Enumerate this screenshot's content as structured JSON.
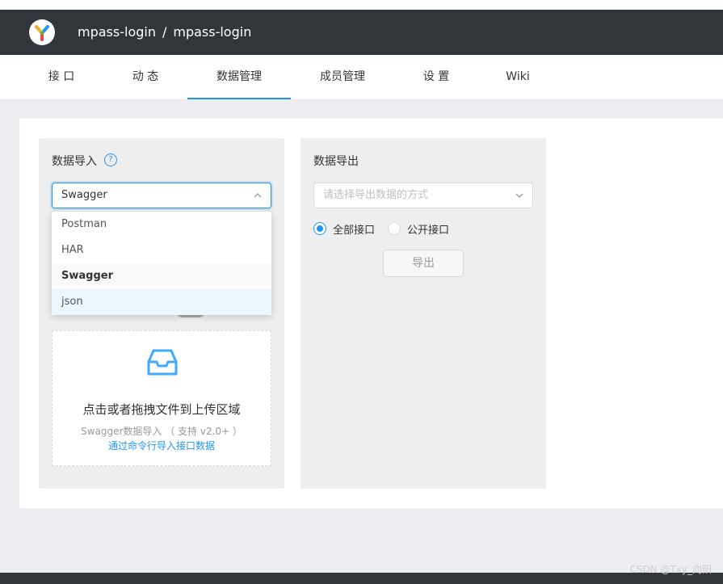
{
  "header": {
    "logo_icon": "yapi-logo",
    "group": "mpass-login",
    "separator": "/",
    "project": "mpass-login"
  },
  "tabs": [
    {
      "label": "接 口"
    },
    {
      "label": "动 态"
    },
    {
      "label": "数据管理",
      "active": true
    },
    {
      "label": "成员管理"
    },
    {
      "label": "设 置"
    },
    {
      "label": "Wiki"
    }
  ],
  "import_panel": {
    "title": "数据导入",
    "help_icon": "question-circle-icon",
    "select_value": "Swagger",
    "options": [
      "Postman",
      "HAR",
      "Swagger",
      "json"
    ],
    "selected_option": "Swagger",
    "upload": {
      "icon": "inbox-icon",
      "text": "点击或者拖拽文件到上传区域",
      "hint": "Swagger数据导入 （ 支持 v2.0+ ）",
      "link": "通过命令行导入接口数据"
    }
  },
  "export_panel": {
    "title": "数据导出",
    "select_placeholder": "请选择导出数据的方式",
    "radios": [
      {
        "label": "全部接口",
        "checked": true
      },
      {
        "label": "公开接口",
        "checked": false
      }
    ],
    "button_label": "导出"
  },
  "watermark": "CSDN @Txy_向阳",
  "colors": {
    "header_bg": "#32363a",
    "accent": "#2395f1",
    "panel_bg": "#eeeeee",
    "page_bg": "#eceef1"
  }
}
